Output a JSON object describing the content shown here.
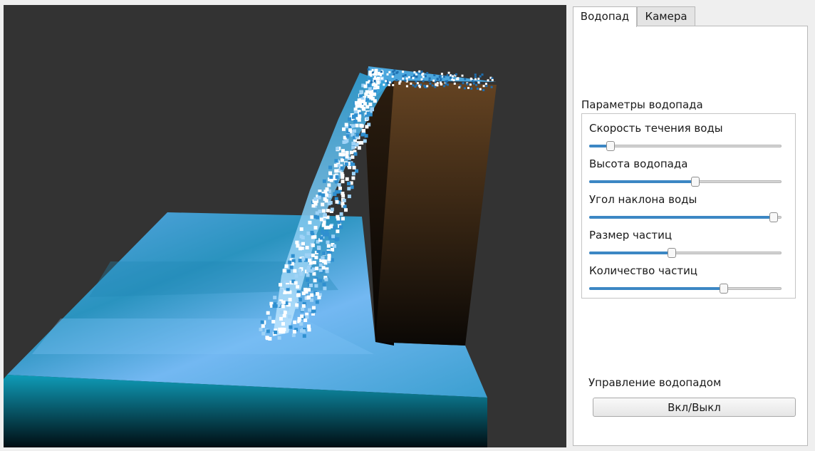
{
  "tabs": [
    {
      "label": "Водопад",
      "active": true
    },
    {
      "label": "Камера",
      "active": false
    }
  ],
  "parameters": {
    "title": "Параметры водопада",
    "sliders": [
      {
        "label": "Скорость течения воды",
        "value": 0.11
      },
      {
        "label": "Высота водопада",
        "value": 0.55
      },
      {
        "label": "Угол наклона воды",
        "value": 0.96
      },
      {
        "label": "Размер частиц",
        "value": 0.43
      },
      {
        "label": "Количество частиц",
        "value": 0.7
      }
    ]
  },
  "control": {
    "title": "Управление водопадом",
    "toggle_label": "Вкл/Выкл"
  },
  "colors": {
    "viewport_bg": "#333333",
    "water_light": "#6db4f2",
    "water_dark": "#1f8fb8",
    "water_edge": "#0f9cb8",
    "cliff_top": "#644322",
    "cliff_bottom": "#0b0805",
    "particle": "#ffffff",
    "slider_fill": "#3c87c4"
  }
}
